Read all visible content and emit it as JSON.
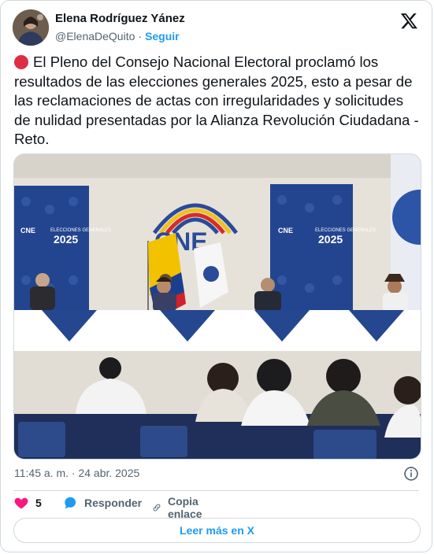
{
  "author": {
    "name": "Elena Rodríguez Yánez",
    "handle": "@ElenaDeQuito",
    "separator": "·",
    "follow_label": "Seguir"
  },
  "tweet": {
    "text": "El Pleno del Consejo Nacional Electoral proclamó los resultados de las elecciones generales 2025, esto a pesar de las reclamaciones de actas con irregularidades y solicitudes de nulidad presentadas por la Alianza Revolución Ciudadana - Reto.",
    "lead_icon": "red-circle-emoji",
    "timestamp": "11:45 a. m. · 24 abr. 2025"
  },
  "media": {
    "logo_text": "CNE",
    "banner_text_top": "ELECCIONES GENERALES",
    "banner_text_year": "2025",
    "colors": {
      "banner": "#23458f",
      "wall": "#e7e4dc",
      "table": "#ffffff",
      "flag_yellow": "#f2c200",
      "flag_red": "#d3202c"
    }
  },
  "actions": {
    "like_count": "5",
    "reply_label": "Responder",
    "copy_label": "Copia enlace"
  },
  "footer": {
    "read_more_label": "Leer más en X"
  },
  "colors": {
    "accent": "#1d9bf0",
    "like": "#f91880",
    "text": "#0f1419",
    "muted": "#536471",
    "border": "#cfd9de"
  }
}
